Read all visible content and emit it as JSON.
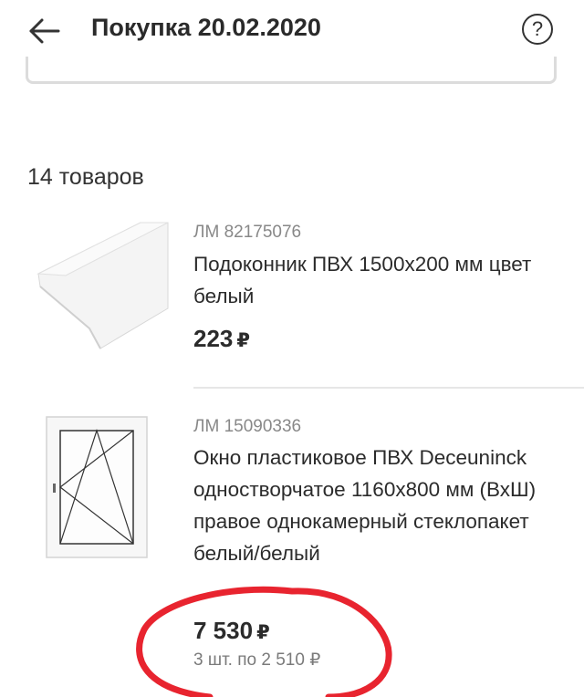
{
  "header": {
    "title": "Покупка 20.02.2020",
    "help_label": "?"
  },
  "items_count": "14 товаров",
  "products": [
    {
      "sku": "ЛМ 82175076",
      "name": "Подоконник ПВХ 1500х200 мм цвет белый",
      "price": "223",
      "currency": "₽"
    },
    {
      "sku": "ЛМ 15090336",
      "name": "Окно пластиковое ПВХ Deceuninck одностворчатое 1160х800 мм (ВхШ) правое однокамерный стеклопакет белый/белый",
      "price": "7 530",
      "currency": "₽",
      "unit_price": "3 шт. по 2 510 ₽"
    }
  ],
  "annotation_color": "#e8242f",
  "icons": [
    "arrow-left-icon",
    "help-circle-icon"
  ]
}
